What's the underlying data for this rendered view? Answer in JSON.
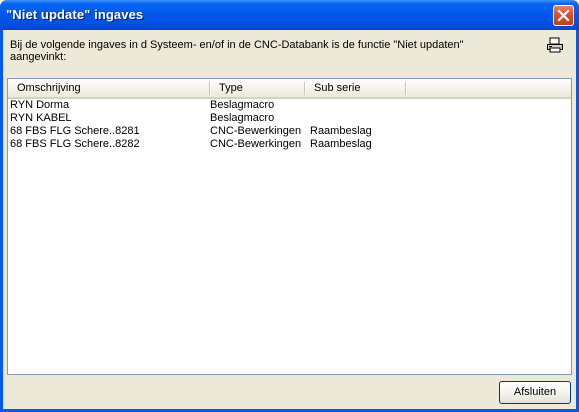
{
  "window": {
    "title": "\"Niet update\" ingaves"
  },
  "intro_text": "Bij de volgende ingaves in d Systeem- en/of in de CNC-Databank is de functie \"Niet updaten\"\naangevinkt:",
  "list": {
    "columns": [
      "Omschrijving",
      "Type",
      "Sub serie"
    ],
    "rows": [
      {
        "omschrijving": "RYN Dorma",
        "type": "Beslagmacro",
        "sub_serie": ""
      },
      {
        "omschrijving": "RYN KABEL",
        "type": "Beslagmacro",
        "sub_serie": ""
      },
      {
        "omschrijving": "68 FBS FLG Schere..8281",
        "type": "CNC-Bewerkingen",
        "sub_serie": "Raambeslag"
      },
      {
        "omschrijving": "68 FBS FLG Schere..8282",
        "type": "CNC-Bewerkingen",
        "sub_serie": "Raambeslag"
      }
    ]
  },
  "buttons": {
    "close_label": "Afsluiten"
  },
  "icons": {
    "close": "close-icon",
    "print": "printer-icon"
  }
}
